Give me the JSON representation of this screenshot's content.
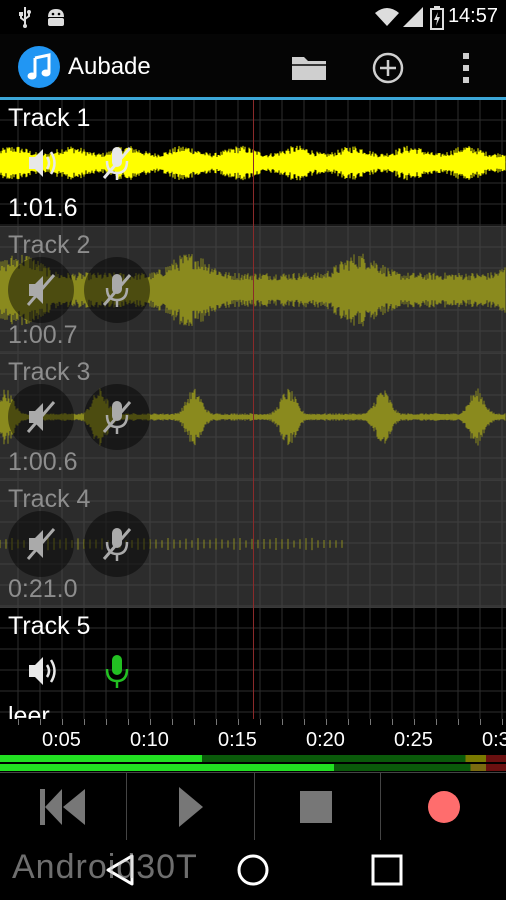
{
  "status_bar": {
    "time": "14:57",
    "icons": [
      "usb-icon",
      "android-debug-icon",
      "wifi-icon",
      "signal-icon",
      "battery-icon"
    ]
  },
  "app_bar": {
    "title": "Aubade",
    "logo_icon": "music-note-icon",
    "actions": [
      "folder-icon",
      "add-circle-icon",
      "overflow-menu-icon"
    ]
  },
  "colors": {
    "accent": "#3ca7d8",
    "wave_active": "#ffff00",
    "wave_muted": "#8a8a1e",
    "record": "#ff6d6d",
    "mic_armed": "#22c022",
    "playhead": "#8a2a2a"
  },
  "tracks": [
    {
      "name": "Track 1",
      "time": "1:01.6",
      "muted": false,
      "armed": false,
      "dimmed": false
    },
    {
      "name": "Track 2",
      "time": "1:00.7",
      "muted": true,
      "armed": false,
      "dimmed": true
    },
    {
      "name": "Track 3",
      "time": "1:00.6",
      "muted": true,
      "armed": false,
      "dimmed": true
    },
    {
      "name": "Track 4",
      "time": "0:21.0",
      "muted": true,
      "armed": false,
      "dimmed": true
    },
    {
      "name": "Track 5",
      "time": "leer",
      "muted": false,
      "armed": true,
      "dimmed": false
    }
  ],
  "timeline": {
    "ticks": [
      "0:05",
      "0:10",
      "0:15",
      "0:20",
      "0:25",
      "0:3"
    ]
  },
  "meters": [
    {
      "level": 0.4
    },
    {
      "level": 0.66
    }
  ],
  "transport": [
    "rewind-to-start-icon",
    "play-icon",
    "stop-icon",
    "record-icon"
  ],
  "nav_bar": [
    "back-icon",
    "home-icon",
    "recents-icon"
  ],
  "watermark": "Android30T"
}
